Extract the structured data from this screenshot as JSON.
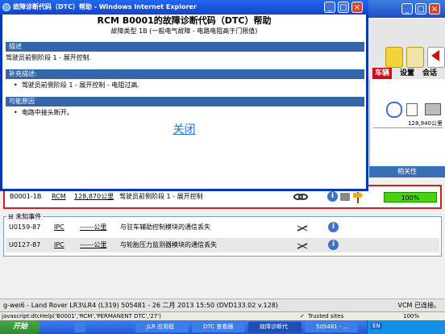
{
  "background_app": {
    "nav": [
      "车辆",
      "设置",
      "会话"
    ],
    "side_value": "128,940公里",
    "related_label": "相关性",
    "main_row": {
      "code": "B0001-1B",
      "module": "RCM",
      "mileage": "128,870公里",
      "description": "驾驶员前侧阶段 1 - 展开控制",
      "progress": "100%"
    },
    "unknown_events": {
      "label": "未知事件",
      "rows": [
        {
          "code": "U0159-87",
          "module": "IPC",
          "mileage": "------公里",
          "description": "与驻车辅助控制模块的通信丢失"
        },
        {
          "code": "U0127-87",
          "module": "IPC",
          "mileage": "------公里",
          "description": "与轮胎压力监测器模块的通信丢失"
        }
      ]
    },
    "status_bar": {
      "left": "g-wei6 - Land Rover LR3\\LR4 (L319) 505481 - 26 二月 2013 15:50 (DVD133.02 v.128)",
      "right": "VCM 已连接。"
    }
  },
  "ie_status": {
    "script": "javascript:dtcHelp('B0001','RCM','PERMANENT DTC','27')",
    "zone": "Trusted sites",
    "zoom": "100%"
  },
  "taskbar": {
    "start": "开始",
    "tasks": [
      "",
      "JLR 应用程",
      "DTC 查看器",
      "故障诊断代",
      "505481 - ..."
    ],
    "tray_lang": "EN"
  },
  "popup": {
    "window_title": "故障诊断代码（DTC）帮助 - Windows Internet Explorer",
    "title": "RCM B0001的故障诊断代码（DTC）帮助",
    "subtitle": "故障类型 1B (一般电气故障 - 电路电阻高于门限值)",
    "sections": [
      {
        "heading": "描述",
        "text": "驾驶员前侧阶段 1 - 展开控制."
      },
      {
        "heading": "补充描述:",
        "bullet": "驾驶员前侧阶段 1 - 展开控制 - 电阻过高."
      },
      {
        "heading": "可能原因",
        "bullet": "电路中接头断开。"
      }
    ],
    "close_link": "关闭"
  },
  "icons": [
    "ie-logo-icon",
    "minimize-icon",
    "maximize-icon",
    "close-icon",
    "info-icon",
    "folder-icon",
    "signpost-icon",
    "link-icon",
    "clock-icon",
    "printer-icon",
    "help-icon",
    "key-icon"
  ]
}
